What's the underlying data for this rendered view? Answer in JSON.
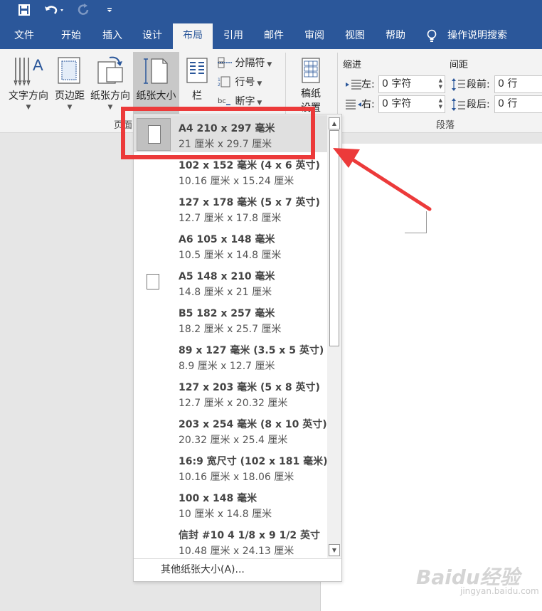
{
  "qat": {
    "save_icon": "save-icon",
    "undo_icon": "undo-icon",
    "redo_icon": "redo-icon",
    "customize_icon": "customize-qat-icon"
  },
  "tabs": [
    {
      "label": "文件"
    },
    {
      "label": "开始"
    },
    {
      "label": "插入"
    },
    {
      "label": "设计"
    },
    {
      "label": "布局"
    },
    {
      "label": "引用"
    },
    {
      "label": "邮件"
    },
    {
      "label": "审阅"
    },
    {
      "label": "视图"
    },
    {
      "label": "帮助"
    },
    {
      "label": "操作说明搜索"
    }
  ],
  "ribbon": {
    "page_setup": {
      "text_direction": "文字方向",
      "margins": "页边距",
      "orientation": "纸张方向",
      "size": "纸张大小",
      "columns": "栏",
      "breaks": "分隔符",
      "line_numbers": "行号",
      "hyphenation": "断字",
      "group_label": "页面"
    },
    "manuscript": {
      "label_line1": "稿纸",
      "label_line2": "设置"
    },
    "paragraph": {
      "indent_title": "缩进",
      "spacing_title": "间距",
      "indent_left_label": "左:",
      "indent_left_value": "0 字符",
      "indent_right_label": "右:",
      "indent_right_value": "0 字符",
      "space_before_label": "段前:",
      "space_before_value": "0 行",
      "space_after_label": "段后:",
      "space_after_value": "0 行",
      "group_label": "段落"
    }
  },
  "dropdown": {
    "items": [
      {
        "name": "A4 210 x 297 毫米",
        "size": "21 厘米 x 29.7 厘米"
      },
      {
        "name": "102 x 152 毫米 (4 x 6 英寸)",
        "size": "10.16 厘米 x 15.24 厘米"
      },
      {
        "name": "127 x 178 毫米 (5 x 7 英寸)",
        "size": "12.7 厘米 x 17.8 厘米"
      },
      {
        "name": "A6 105 x 148 毫米",
        "size": "10.5 厘米 x 14.8 厘米"
      },
      {
        "name": "A5 148 x 210 毫米",
        "size": "14.8 厘米 x 21 厘米"
      },
      {
        "name": "B5 182 x 257 毫米",
        "size": "18.2 厘米 x 25.7 厘米"
      },
      {
        "name": "89 x 127 毫米 (3.5 x 5 英寸)",
        "size": "8.9 厘米 x 12.7 厘米"
      },
      {
        "name": "127 x 203 毫米 (5 x 8 英寸)",
        "size": "12.7 厘米 x 20.32 厘米"
      },
      {
        "name": "203 x 254 毫米 (8 x 10 英寸)",
        "size": "20.32 厘米 x 25.4 厘米"
      },
      {
        "name": "16:9 宽尺寸 (102 x 181 毫米)",
        "size": "10.16 厘米 x 18.06 厘米"
      },
      {
        "name": "100 x 148 毫米",
        "size": "10 厘米 x 14.8 厘米"
      },
      {
        "name": "信封 #10 4 1/8 x 9 1/2 英寸",
        "size": "10.48 厘米 x 24.13 厘米"
      }
    ],
    "more_sizes": "其他纸张大小(A)..."
  },
  "watermark": {
    "main": "Baidu经验",
    "sub": "jingyan.baidu.com"
  },
  "colors": {
    "title_bar": "#2b579a",
    "ribbon_bg": "#f3f3f3",
    "highlight": "#ec3a3a"
  }
}
